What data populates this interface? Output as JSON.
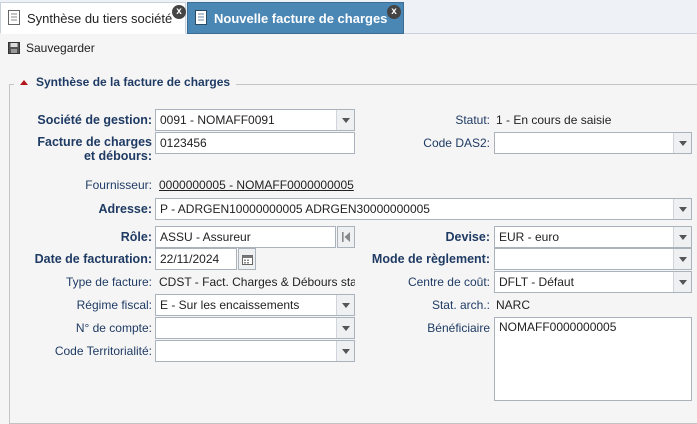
{
  "tabs": [
    {
      "label": "Synthèse du tiers société"
    },
    {
      "label": "Nouvelle facture de charges"
    }
  ],
  "toolbar": {
    "save_label": "Sauvegarder"
  },
  "section": {
    "title": "Synthèse de la facture de charges"
  },
  "form": {
    "societe_gestion": {
      "label": "Société de gestion:",
      "value": "0091 - NOMAFF0091"
    },
    "statut": {
      "label": "Statut:",
      "value": "1 - En cours de saisie"
    },
    "facture": {
      "label_line1": "Facture de charges",
      "label_line2": "et débours:",
      "value": "0123456"
    },
    "code_das2": {
      "label": "Code DAS2:",
      "value": ""
    },
    "fournisseur": {
      "label": "Fournisseur:",
      "value": "0000000005 - NOMAFF0000000005"
    },
    "adresse": {
      "label": "Adresse:",
      "value": "P - ADRGEN10000000005  ADRGEN30000000005"
    },
    "role": {
      "label": "Rôle:",
      "value": "ASSU - Assureur"
    },
    "devise": {
      "label": "Devise:",
      "value": "EUR - euro"
    },
    "date_facturation": {
      "label": "Date de facturation:",
      "value": "22/11/2024"
    },
    "mode_reglement": {
      "label": "Mode de règlement:",
      "value": ""
    },
    "type_facture": {
      "label": "Type de facture:",
      "value": "CDST - Fact. Charges & Débours stan"
    },
    "centre_cout": {
      "label": "Centre de coût:",
      "value": "DFLT - Défaut"
    },
    "regime_fiscal": {
      "label": "Régime fiscal:",
      "value": "E - Sur les encaissements"
    },
    "stat_arch": {
      "label": "Stat. arch.:",
      "value": "NARC"
    },
    "num_compte": {
      "label": "N° de compte:",
      "value": ""
    },
    "beneficiaire": {
      "label": "Bénéficiaire",
      "value": "NOMAFF0000000005"
    },
    "code_territorialite": {
      "label": "Code Territorialité:",
      "value": ""
    }
  },
  "colors": {
    "tab_active_bg": "#4a87b5",
    "label_color": "#1f3b64",
    "legend_arrow": "#b3131a"
  },
  "icons": [
    "document-icon",
    "close-icon",
    "save-disk-icon",
    "calendar-icon",
    "skip-first-icon",
    "chevron-down-icon"
  ]
}
